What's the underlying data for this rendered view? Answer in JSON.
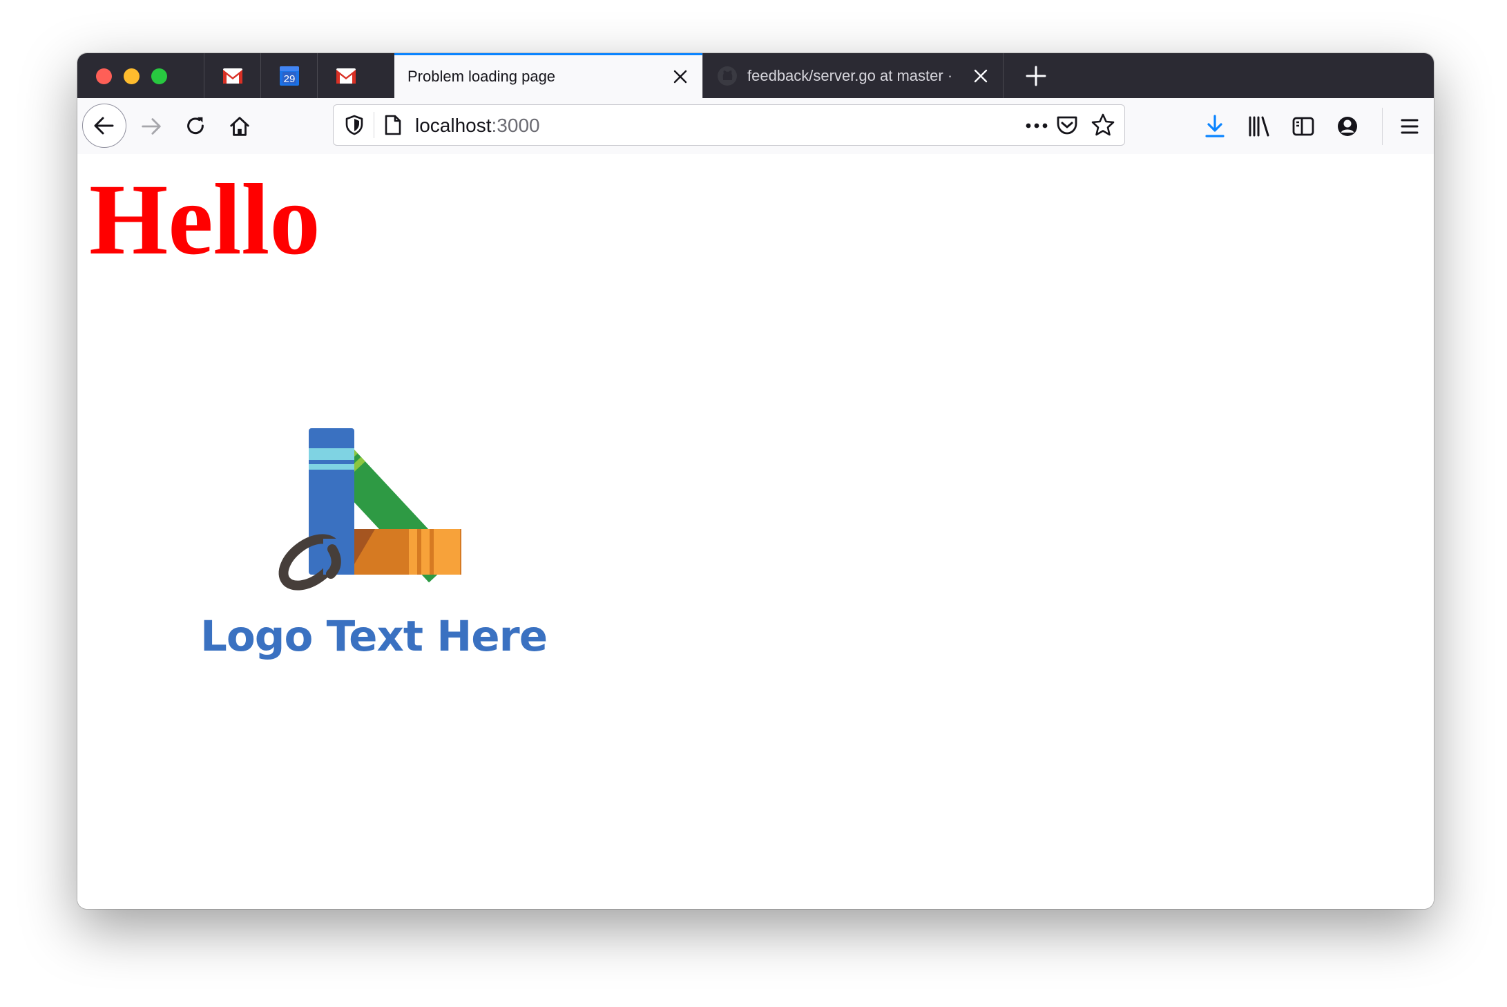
{
  "tabs": {
    "pinned": [
      {
        "name": "gmail-icon"
      },
      {
        "name": "calendar-icon",
        "day": "29"
      },
      {
        "name": "gmail-icon"
      }
    ],
    "active": {
      "title": "Problem loading page"
    },
    "inactive": {
      "title": "feedback/server.go at master · ",
      "icon": "github-icon"
    }
  },
  "urlbar": {
    "host": "localhost",
    "port": ":3000"
  },
  "page": {
    "heading": "Hello",
    "logo_text": "Logo Text Here"
  },
  "colors": {
    "heading": "#ff0000",
    "accent": "#0a84ff",
    "logo_blue": "#3a71c1",
    "logo_green": "#2e9a44",
    "logo_orange": "#d67a22"
  },
  "icons": [
    "back-icon",
    "forward-icon",
    "reload-icon",
    "home-icon",
    "shield-icon",
    "page-icon",
    "more-icon",
    "pocket-icon",
    "star-icon",
    "download-icon",
    "library-icon",
    "sidebar-icon",
    "account-icon",
    "menu-icon",
    "close-icon",
    "plus-icon"
  ]
}
